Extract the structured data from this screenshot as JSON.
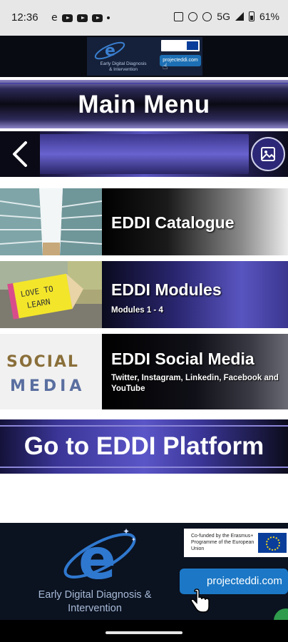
{
  "status_bar": {
    "time": "12:36",
    "left_letter": "e",
    "network": "5G",
    "battery": "61%"
  },
  "header": {
    "title": "Main Menu"
  },
  "menu_items": [
    {
      "label": "EDDI Catalogue",
      "subtitle": ""
    },
    {
      "label": "EDDI Modules",
      "subtitle": "Modules 1 - 4",
      "thumbnail_text": [
        "LOVE TO",
        "LEARN"
      ]
    },
    {
      "label": "EDDI Social Media",
      "subtitle": "Twitter, Instagram, Linkedin, Facebook and YouTube",
      "thumbnail_text": [
        "SOCIAL",
        "MEDIA"
      ]
    }
  ],
  "platform_button": {
    "label": "Go to EDDI Platform"
  },
  "banners": {
    "top": {
      "logo_caption": "Early Digital Diagnosis & Intervention",
      "url_button": "projecteddi.com"
    },
    "bottom": {
      "logo_caption": "Early Digital Diagnosis & Intervention",
      "eu_text": "Co-funded by the Erasmus+ Programme of the European Union",
      "url_button": "projecteddi.com"
    }
  },
  "colors": {
    "accent_purple": "#5b56c8",
    "dark_navy": "#0b1220",
    "link_blue": "#1c78c6"
  },
  "icons": [
    "back-arrow-icon",
    "image-gallery-icon",
    "youtube-icon",
    "hand-pointer-icon"
  ]
}
